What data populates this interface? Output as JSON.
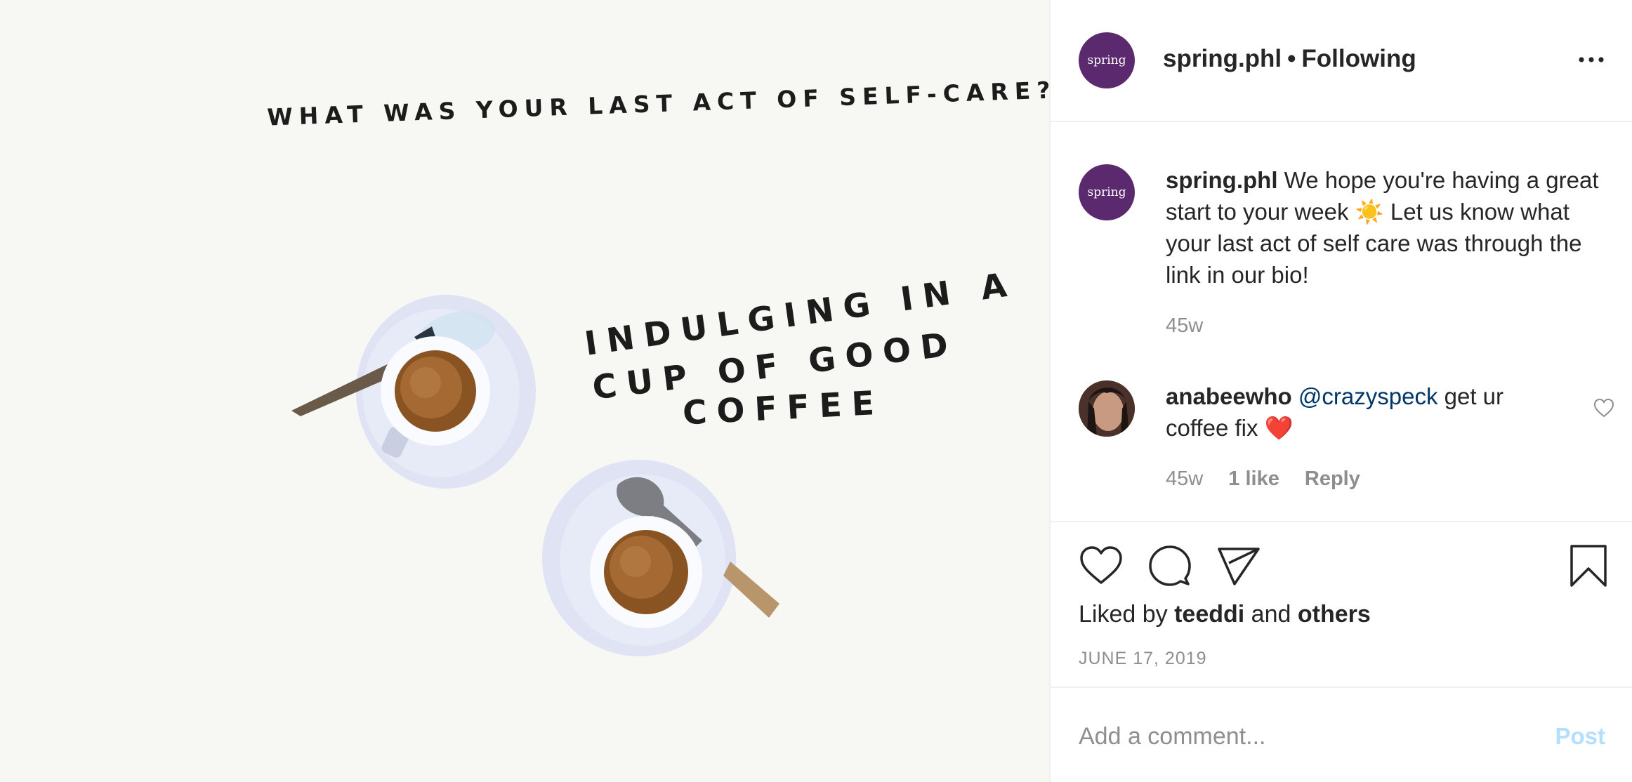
{
  "post": {
    "image_text": {
      "question": "WHAT WAS YOUR LAST ACT OF SELF-CARE?",
      "answer_line1": "INDULGING IN A",
      "answer_line2": "CUP OF GOOD",
      "answer_line3": "COFFEE"
    }
  },
  "header": {
    "avatar_text": "spring",
    "username": "spring.phl",
    "separator": "•",
    "follow_status": "Following",
    "more_icon": "more-horizontal-icon"
  },
  "caption": {
    "avatar_text": "spring",
    "username": "spring.phl",
    "text_part1": "We hope you're having a great start to your week",
    "emoji": "☀️",
    "text_part2": "Let us know what your last act of self care was through the link in our bio!",
    "time": "45w"
  },
  "comment": {
    "username": "anabeewho",
    "mention": "@crazyspeck",
    "text": "get ur coffee fix",
    "emoji": "❤️",
    "time": "45w",
    "likes": "1 like",
    "reply_label": "Reply",
    "like_icon": "heart-outline-icon"
  },
  "actions": {
    "like_icon": "heart-icon",
    "comment_icon": "comment-bubble-icon",
    "share_icon": "paper-plane-icon",
    "save_icon": "bookmark-icon"
  },
  "likes": {
    "prefix": "Liked by",
    "user": "teeddi",
    "and": "and",
    "others": "others"
  },
  "post_date": "JUNE 17, 2019",
  "add_comment": {
    "placeholder": "Add a comment...",
    "post_label": "Post"
  },
  "colors": {
    "brand_avatar": "#5b2a6e",
    "post_button_disabled": "#b2dffc",
    "mention": "#00376b",
    "muted_text": "#8e8e8e",
    "image_background": "#f7f7f3"
  }
}
